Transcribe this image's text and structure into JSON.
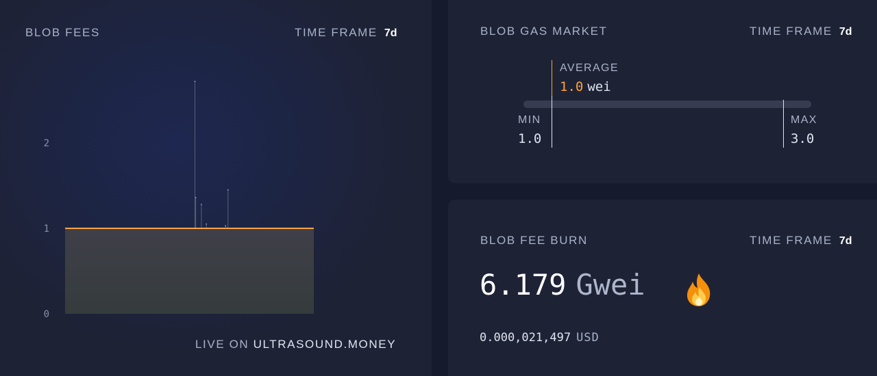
{
  "blob_fees": {
    "title": "BLOB FEES",
    "time_frame_label": "TIME FRAME",
    "time_frame_value": "7d",
    "footer_prefix": "LIVE ON",
    "footer_brand": "ULTRASOUND.MONEY",
    "chart_data": {
      "type": "area",
      "title": "",
      "xlabel": "",
      "ylabel": "",
      "y_ticks": [
        "0",
        "1",
        "2"
      ],
      "ylim": [
        0,
        2.5
      ],
      "grid": false,
      "series": [
        {
          "x": [
            0,
            100
          ],
          "values": [
            1.0,
            1.0
          ]
        }
      ],
      "spikes": [
        {
          "x": 52.2,
          "value": 2.72
        },
        {
          "x": 52.5,
          "value": 1.36
        },
        {
          "x": 54.8,
          "value": 1.28
        },
        {
          "x": 56.8,
          "value": 1.05
        },
        {
          "x": 65.5,
          "value": 1.45
        },
        {
          "x": 64.5,
          "value": 1.03
        }
      ],
      "colors": {
        "line": "#ffa33d",
        "fill_top": "#3f3f48",
        "fill_bottom": "#353c3d"
      }
    }
  },
  "gas_market": {
    "title": "BLOB GAS MARKET",
    "time_frame_label": "TIME FRAME",
    "time_frame_value": "7d",
    "average_label": "AVERAGE",
    "average_value": "1.0",
    "average_unit": "wei",
    "min_label": "MIN",
    "min_value": "1.0",
    "max_label": "MAX",
    "max_value": "3.0",
    "colors": {
      "accent": "#ffa33d"
    }
  },
  "burn": {
    "title": "BLOB FEE BURN",
    "time_frame_label": "TIME FRAME",
    "time_frame_value": "7d",
    "amount": "6.179",
    "unit": "Gwei",
    "usd_amount": "0.000,021,497",
    "usd_currency": "USD",
    "icon": "fire-icon"
  }
}
